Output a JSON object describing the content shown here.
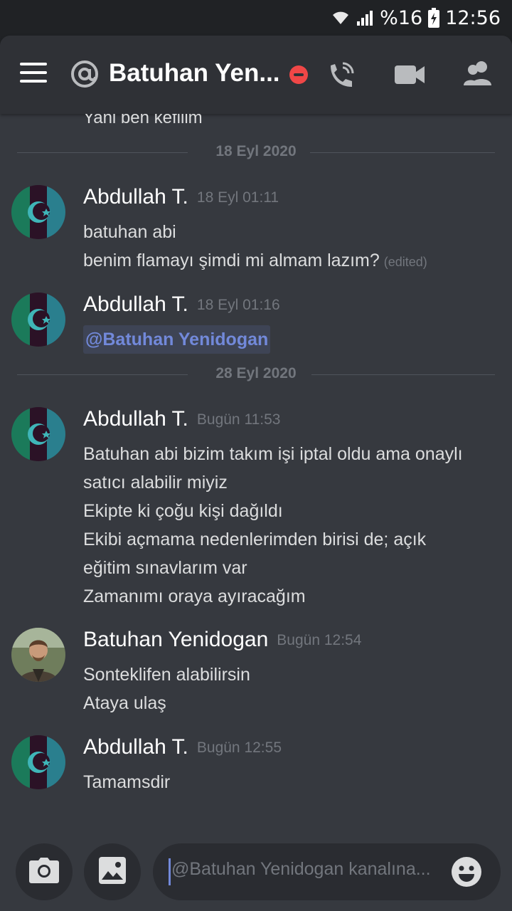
{
  "status_bar": {
    "battery": "%16",
    "time": "12:56"
  },
  "header": {
    "channel_title": "Batuhan Yen...",
    "presence": "do-not-disturb",
    "icons": [
      "menu-icon",
      "at-icon",
      "call-icon",
      "video-icon",
      "members-icon"
    ]
  },
  "chat": {
    "previous_line": "Yani ben kefilim",
    "dividers": [
      "18 Eyl 2020",
      "28 Eyl 2020"
    ],
    "messages": [
      {
        "author": "Abdullah T.",
        "time": "18 Eyl 01:11",
        "lines": [
          "batuhan abi",
          "benim flamayı şimdi mi almam lazım?"
        ],
        "edited_label": "(edited)"
      },
      {
        "author": "Abdullah T.",
        "time": "18 Eyl 01:16",
        "mention": "@Batuhan Yenidogan"
      },
      {
        "author": "Abdullah T.",
        "time": "Bugün 11:53",
        "lines": [
          "Batuhan abi bizim takım işi iptal oldu ama onaylı",
          "satıcı alabilir miyiz",
          "Ekipte ki çoğu kişi dağıldı",
          "Ekibi açmama nedenlerimden birisi de; açık",
          "eğitim sınavlarım var",
          "Zamanımı oraya ayıracağım"
        ]
      },
      {
        "author": "Batuhan Yenidogan",
        "time": "Bugün 12:54",
        "lines": [
          "Sonteklifen alabilirsin",
          "Ataya ulaş"
        ]
      },
      {
        "author": "Abdullah T.",
        "time": "Bugün 12:55",
        "lines": [
          "Tamamsdir"
        ]
      }
    ]
  },
  "composer": {
    "placeholder": "@Batuhan Yenidogan kanalına...",
    "icons": [
      "camera-icon",
      "image-icon",
      "emoji-icon"
    ]
  },
  "colors": {
    "background": "#36393f",
    "header": "#2f3136",
    "mention": "#7289da",
    "dnd": "#f04747",
    "muted": "#72767d"
  }
}
